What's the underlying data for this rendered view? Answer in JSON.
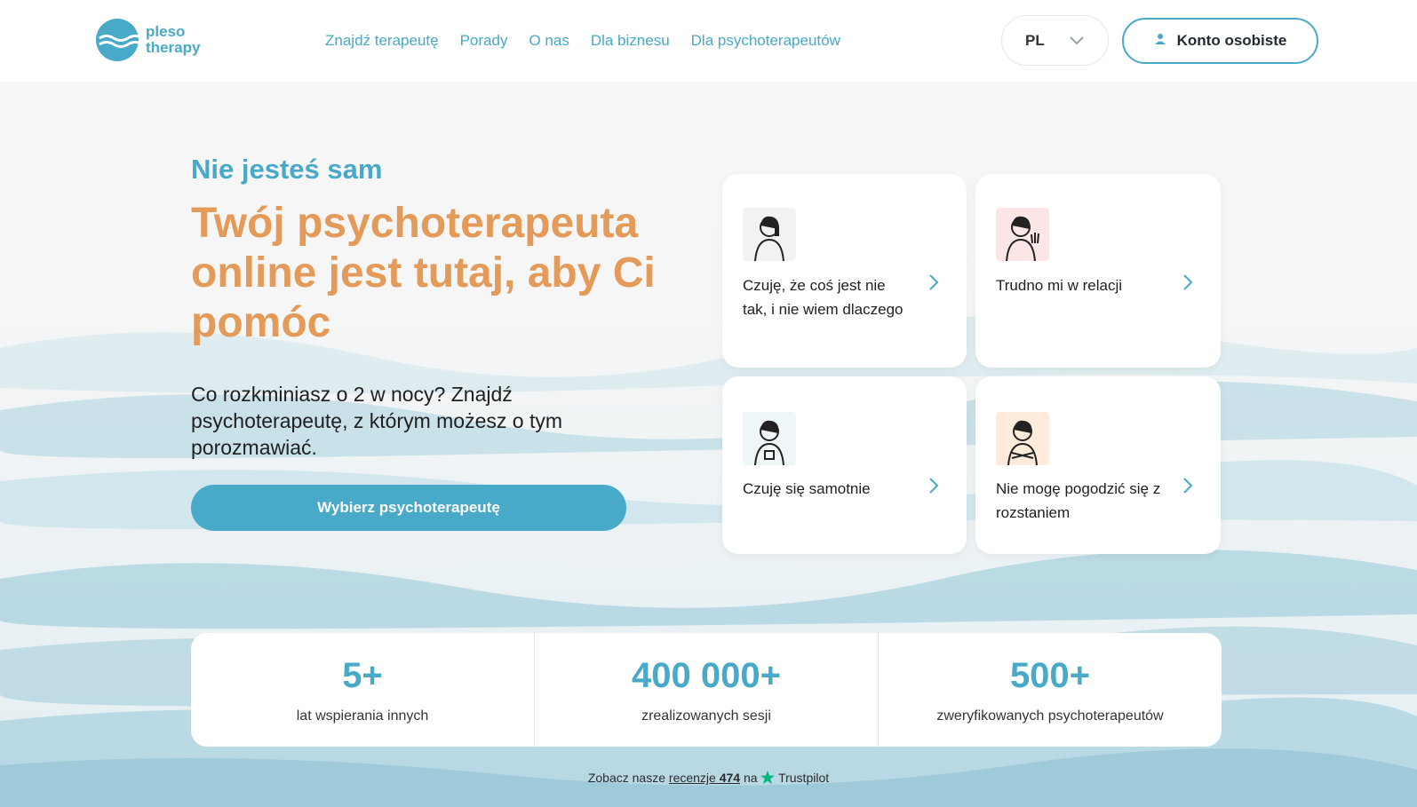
{
  "header": {
    "logo_line1": "pleso",
    "logo_line2": "therapy",
    "nav": [
      "Znajdź terapeutę",
      "Porady",
      "O nas",
      "Dla biznesu",
      "Dla psychoterapeutów"
    ],
    "language": "PL",
    "account_label": "Konto osobiste"
  },
  "hero": {
    "kicker": "Nie jesteś sam",
    "headline": "Twój psychoterapeuta online jest tutaj, aby Ci pomóc",
    "lead": "Co rozkminiasz o 2 w nocy? Znajdź psychoterapeutę, z którym możesz o tym porozmawiać.",
    "cta": "Wybierz psychoterapeutę"
  },
  "cards": [
    {
      "label": "Czuję, że coś jest nie tak, i nie wiem dlaczego",
      "icon": "woman-on-phone-icon",
      "bg": "#f2f2f2"
    },
    {
      "label": "Trudno mi w relacji",
      "icon": "woman-waving-icon",
      "bg": "#fde6e6"
    },
    {
      "label": "Czuję się samotnie",
      "icon": "woman-holding-cup-icon",
      "bg": "#eef6f8"
    },
    {
      "label": "Nie mogę pogodzić się z rozstaniem",
      "icon": "woman-crossed-arms-icon",
      "bg": "#fdebdc"
    }
  ],
  "stats": [
    {
      "num": "5+",
      "desc": "lat wspierania innych"
    },
    {
      "num": "400 000+",
      "desc": "zrealizowanych sesji"
    },
    {
      "num": "500+",
      "desc": "zweryfikowanych psychoterapeutów"
    }
  ],
  "trust": {
    "prefix": "Zobacz nasze",
    "link": "recenzje",
    "count": "474",
    "mid": "na",
    "brand": "Trustpilot"
  },
  "colors": {
    "accent": "#48a9c8",
    "headline": "#e49a58",
    "trustpilot_star": "#00b67a"
  }
}
